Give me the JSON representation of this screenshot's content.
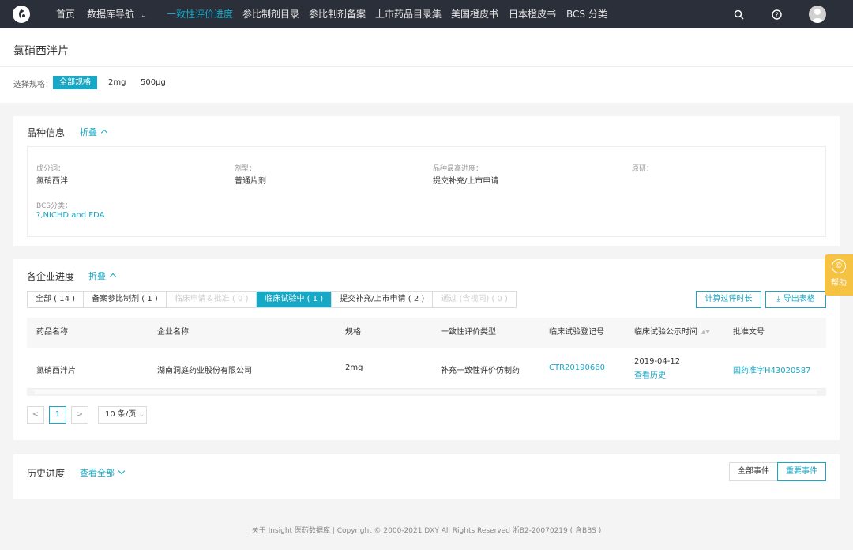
{
  "nav": {
    "items": [
      "首页",
      "数据库导航",
      "一致性评价进度",
      "参比制剂目录",
      "参比制剂备案",
      "上市药品目录集",
      "美国橙皮书",
      "日本橙皮书",
      "BCS 分类"
    ],
    "dropdown_glyph": "⌄",
    "icons": [
      "search-icon",
      "help-icon"
    ]
  },
  "page": {
    "title": "氯硝西泮片",
    "spec_label": "选择规格：",
    "specs": [
      "全部规格",
      "2mg",
      "500μg"
    ]
  },
  "variety": {
    "title": "品种信息",
    "fold": "折叠",
    "fields": [
      {
        "label": "成分词：",
        "value": "氯硝西泮"
      },
      {
        "label": "剂型：",
        "value": "普通片剂"
      },
      {
        "label": "品种最高进度：",
        "value": "提交补充/上市申请"
      },
      {
        "label": "原研：",
        "value": ""
      },
      {
        "label": "BCS分类：",
        "value": "?,NICHD and FDA"
      }
    ]
  },
  "progress": {
    "title": "各企业进度",
    "fold": "折叠",
    "tabs": [
      "全部 ( 14 )",
      "备案参比制剂 ( 1 )",
      "临床申请＆批准 ( 0 )",
      "临床试验中 ( 1 )",
      "提交补充/上市申请 ( 2 )",
      "通过 (含视同) ( 0 )"
    ],
    "calc_button": "计算过评时长",
    "export_button": "导出表格",
    "export_glyph": "⤓",
    "columns": [
      "药品名称",
      "企业名称",
      "规格",
      "一致性评价类型",
      "临床试验登记号",
      "临床试验公示时间",
      "批准文号"
    ],
    "sort_glyph": "▲▼",
    "rows": [
      {
        "drug": "氯硝西泮片",
        "company": "湖南洞庭药业股份有限公司",
        "spec": "2mg",
        "type": "补充一致性评价仿制药",
        "reg_no": "CTR20190660",
        "pub_date": "2019-04-12",
        "history": "查看历史",
        "approval": "国药准字H43020587"
      }
    ],
    "pager": {
      "prev": "<",
      "page": "1",
      "next": ">",
      "size": "10 条/页"
    }
  },
  "history": {
    "title": "历史进度",
    "view_all": "查看全部",
    "segments": [
      "全部事件",
      "重要事件"
    ]
  },
  "footer": {
    "text": "关于 Insight 医药数据库  |  Copyright © 2000-2021 DXY All Rights Reserved  浙B2-20070219 ( 含BBS )"
  },
  "help": {
    "label": "帮助",
    "icon": "©"
  },
  "colors": {
    "accent": "#17a8c6",
    "nav_bg": "#2b2f3a",
    "help": "#f5c242"
  }
}
